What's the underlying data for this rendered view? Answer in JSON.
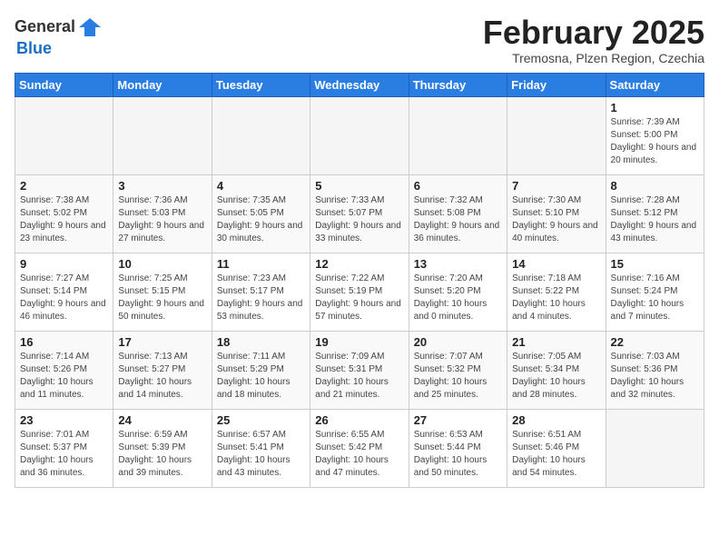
{
  "header": {
    "logo_general": "General",
    "logo_blue": "Blue",
    "title": "February 2025",
    "subtitle": "Tremosna, Plzen Region, Czechia"
  },
  "calendar": {
    "days_of_week": [
      "Sunday",
      "Monday",
      "Tuesday",
      "Wednesday",
      "Thursday",
      "Friday",
      "Saturday"
    ],
    "weeks": [
      [
        {
          "day": "",
          "info": "",
          "empty": true
        },
        {
          "day": "",
          "info": "",
          "empty": true
        },
        {
          "day": "",
          "info": "",
          "empty": true
        },
        {
          "day": "",
          "info": "",
          "empty": true
        },
        {
          "day": "",
          "info": "",
          "empty": true
        },
        {
          "day": "",
          "info": "",
          "empty": true
        },
        {
          "day": "1",
          "info": "Sunrise: 7:39 AM\nSunset: 5:00 PM\nDaylight: 9 hours and 20 minutes.",
          "empty": false
        }
      ],
      [
        {
          "day": "2",
          "info": "Sunrise: 7:38 AM\nSunset: 5:02 PM\nDaylight: 9 hours and 23 minutes.",
          "empty": false
        },
        {
          "day": "3",
          "info": "Sunrise: 7:36 AM\nSunset: 5:03 PM\nDaylight: 9 hours and 27 minutes.",
          "empty": false
        },
        {
          "day": "4",
          "info": "Sunrise: 7:35 AM\nSunset: 5:05 PM\nDaylight: 9 hours and 30 minutes.",
          "empty": false
        },
        {
          "day": "5",
          "info": "Sunrise: 7:33 AM\nSunset: 5:07 PM\nDaylight: 9 hours and 33 minutes.",
          "empty": false
        },
        {
          "day": "6",
          "info": "Sunrise: 7:32 AM\nSunset: 5:08 PM\nDaylight: 9 hours and 36 minutes.",
          "empty": false
        },
        {
          "day": "7",
          "info": "Sunrise: 7:30 AM\nSunset: 5:10 PM\nDaylight: 9 hours and 40 minutes.",
          "empty": false
        },
        {
          "day": "8",
          "info": "Sunrise: 7:28 AM\nSunset: 5:12 PM\nDaylight: 9 hours and 43 minutes.",
          "empty": false
        }
      ],
      [
        {
          "day": "9",
          "info": "Sunrise: 7:27 AM\nSunset: 5:14 PM\nDaylight: 9 hours and 46 minutes.",
          "empty": false
        },
        {
          "day": "10",
          "info": "Sunrise: 7:25 AM\nSunset: 5:15 PM\nDaylight: 9 hours and 50 minutes.",
          "empty": false
        },
        {
          "day": "11",
          "info": "Sunrise: 7:23 AM\nSunset: 5:17 PM\nDaylight: 9 hours and 53 minutes.",
          "empty": false
        },
        {
          "day": "12",
          "info": "Sunrise: 7:22 AM\nSunset: 5:19 PM\nDaylight: 9 hours and 57 minutes.",
          "empty": false
        },
        {
          "day": "13",
          "info": "Sunrise: 7:20 AM\nSunset: 5:20 PM\nDaylight: 10 hours and 0 minutes.",
          "empty": false
        },
        {
          "day": "14",
          "info": "Sunrise: 7:18 AM\nSunset: 5:22 PM\nDaylight: 10 hours and 4 minutes.",
          "empty": false
        },
        {
          "day": "15",
          "info": "Sunrise: 7:16 AM\nSunset: 5:24 PM\nDaylight: 10 hours and 7 minutes.",
          "empty": false
        }
      ],
      [
        {
          "day": "16",
          "info": "Sunrise: 7:14 AM\nSunset: 5:26 PM\nDaylight: 10 hours and 11 minutes.",
          "empty": false
        },
        {
          "day": "17",
          "info": "Sunrise: 7:13 AM\nSunset: 5:27 PM\nDaylight: 10 hours and 14 minutes.",
          "empty": false
        },
        {
          "day": "18",
          "info": "Sunrise: 7:11 AM\nSunset: 5:29 PM\nDaylight: 10 hours and 18 minutes.",
          "empty": false
        },
        {
          "day": "19",
          "info": "Sunrise: 7:09 AM\nSunset: 5:31 PM\nDaylight: 10 hours and 21 minutes.",
          "empty": false
        },
        {
          "day": "20",
          "info": "Sunrise: 7:07 AM\nSunset: 5:32 PM\nDaylight: 10 hours and 25 minutes.",
          "empty": false
        },
        {
          "day": "21",
          "info": "Sunrise: 7:05 AM\nSunset: 5:34 PM\nDaylight: 10 hours and 28 minutes.",
          "empty": false
        },
        {
          "day": "22",
          "info": "Sunrise: 7:03 AM\nSunset: 5:36 PM\nDaylight: 10 hours and 32 minutes.",
          "empty": false
        }
      ],
      [
        {
          "day": "23",
          "info": "Sunrise: 7:01 AM\nSunset: 5:37 PM\nDaylight: 10 hours and 36 minutes.",
          "empty": false
        },
        {
          "day": "24",
          "info": "Sunrise: 6:59 AM\nSunset: 5:39 PM\nDaylight: 10 hours and 39 minutes.",
          "empty": false
        },
        {
          "day": "25",
          "info": "Sunrise: 6:57 AM\nSunset: 5:41 PM\nDaylight: 10 hours and 43 minutes.",
          "empty": false
        },
        {
          "day": "26",
          "info": "Sunrise: 6:55 AM\nSunset: 5:42 PM\nDaylight: 10 hours and 47 minutes.",
          "empty": false
        },
        {
          "day": "27",
          "info": "Sunrise: 6:53 AM\nSunset: 5:44 PM\nDaylight: 10 hours and 50 minutes.",
          "empty": false
        },
        {
          "day": "28",
          "info": "Sunrise: 6:51 AM\nSunset: 5:46 PM\nDaylight: 10 hours and 54 minutes.",
          "empty": false
        },
        {
          "day": "",
          "info": "",
          "empty": true
        }
      ]
    ]
  }
}
